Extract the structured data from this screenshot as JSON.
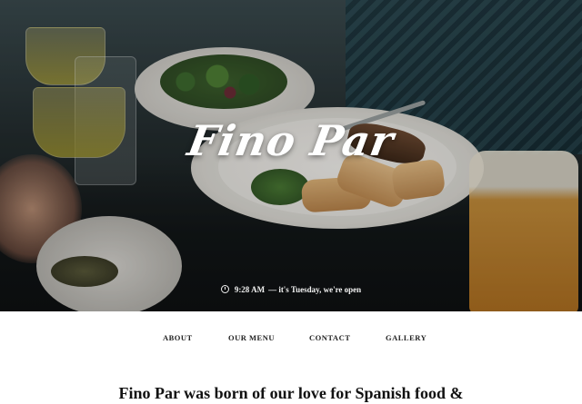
{
  "hero": {
    "title": "Fino Par",
    "status_time": "9:28 AM",
    "status_text": "— it's Tuesday, we're open",
    "icon": "clock-icon"
  },
  "nav": {
    "items": [
      {
        "label": "ABOUT"
      },
      {
        "label": "OUR MENU"
      },
      {
        "label": "CONTACT"
      },
      {
        "label": "GALLERY"
      }
    ]
  },
  "intro": {
    "heading": "Fino Par was born of our love for Spanish food &"
  },
  "colors": {
    "nav_text": "#222222",
    "heading_text": "#111111",
    "hero_text": "#ffffff"
  }
}
